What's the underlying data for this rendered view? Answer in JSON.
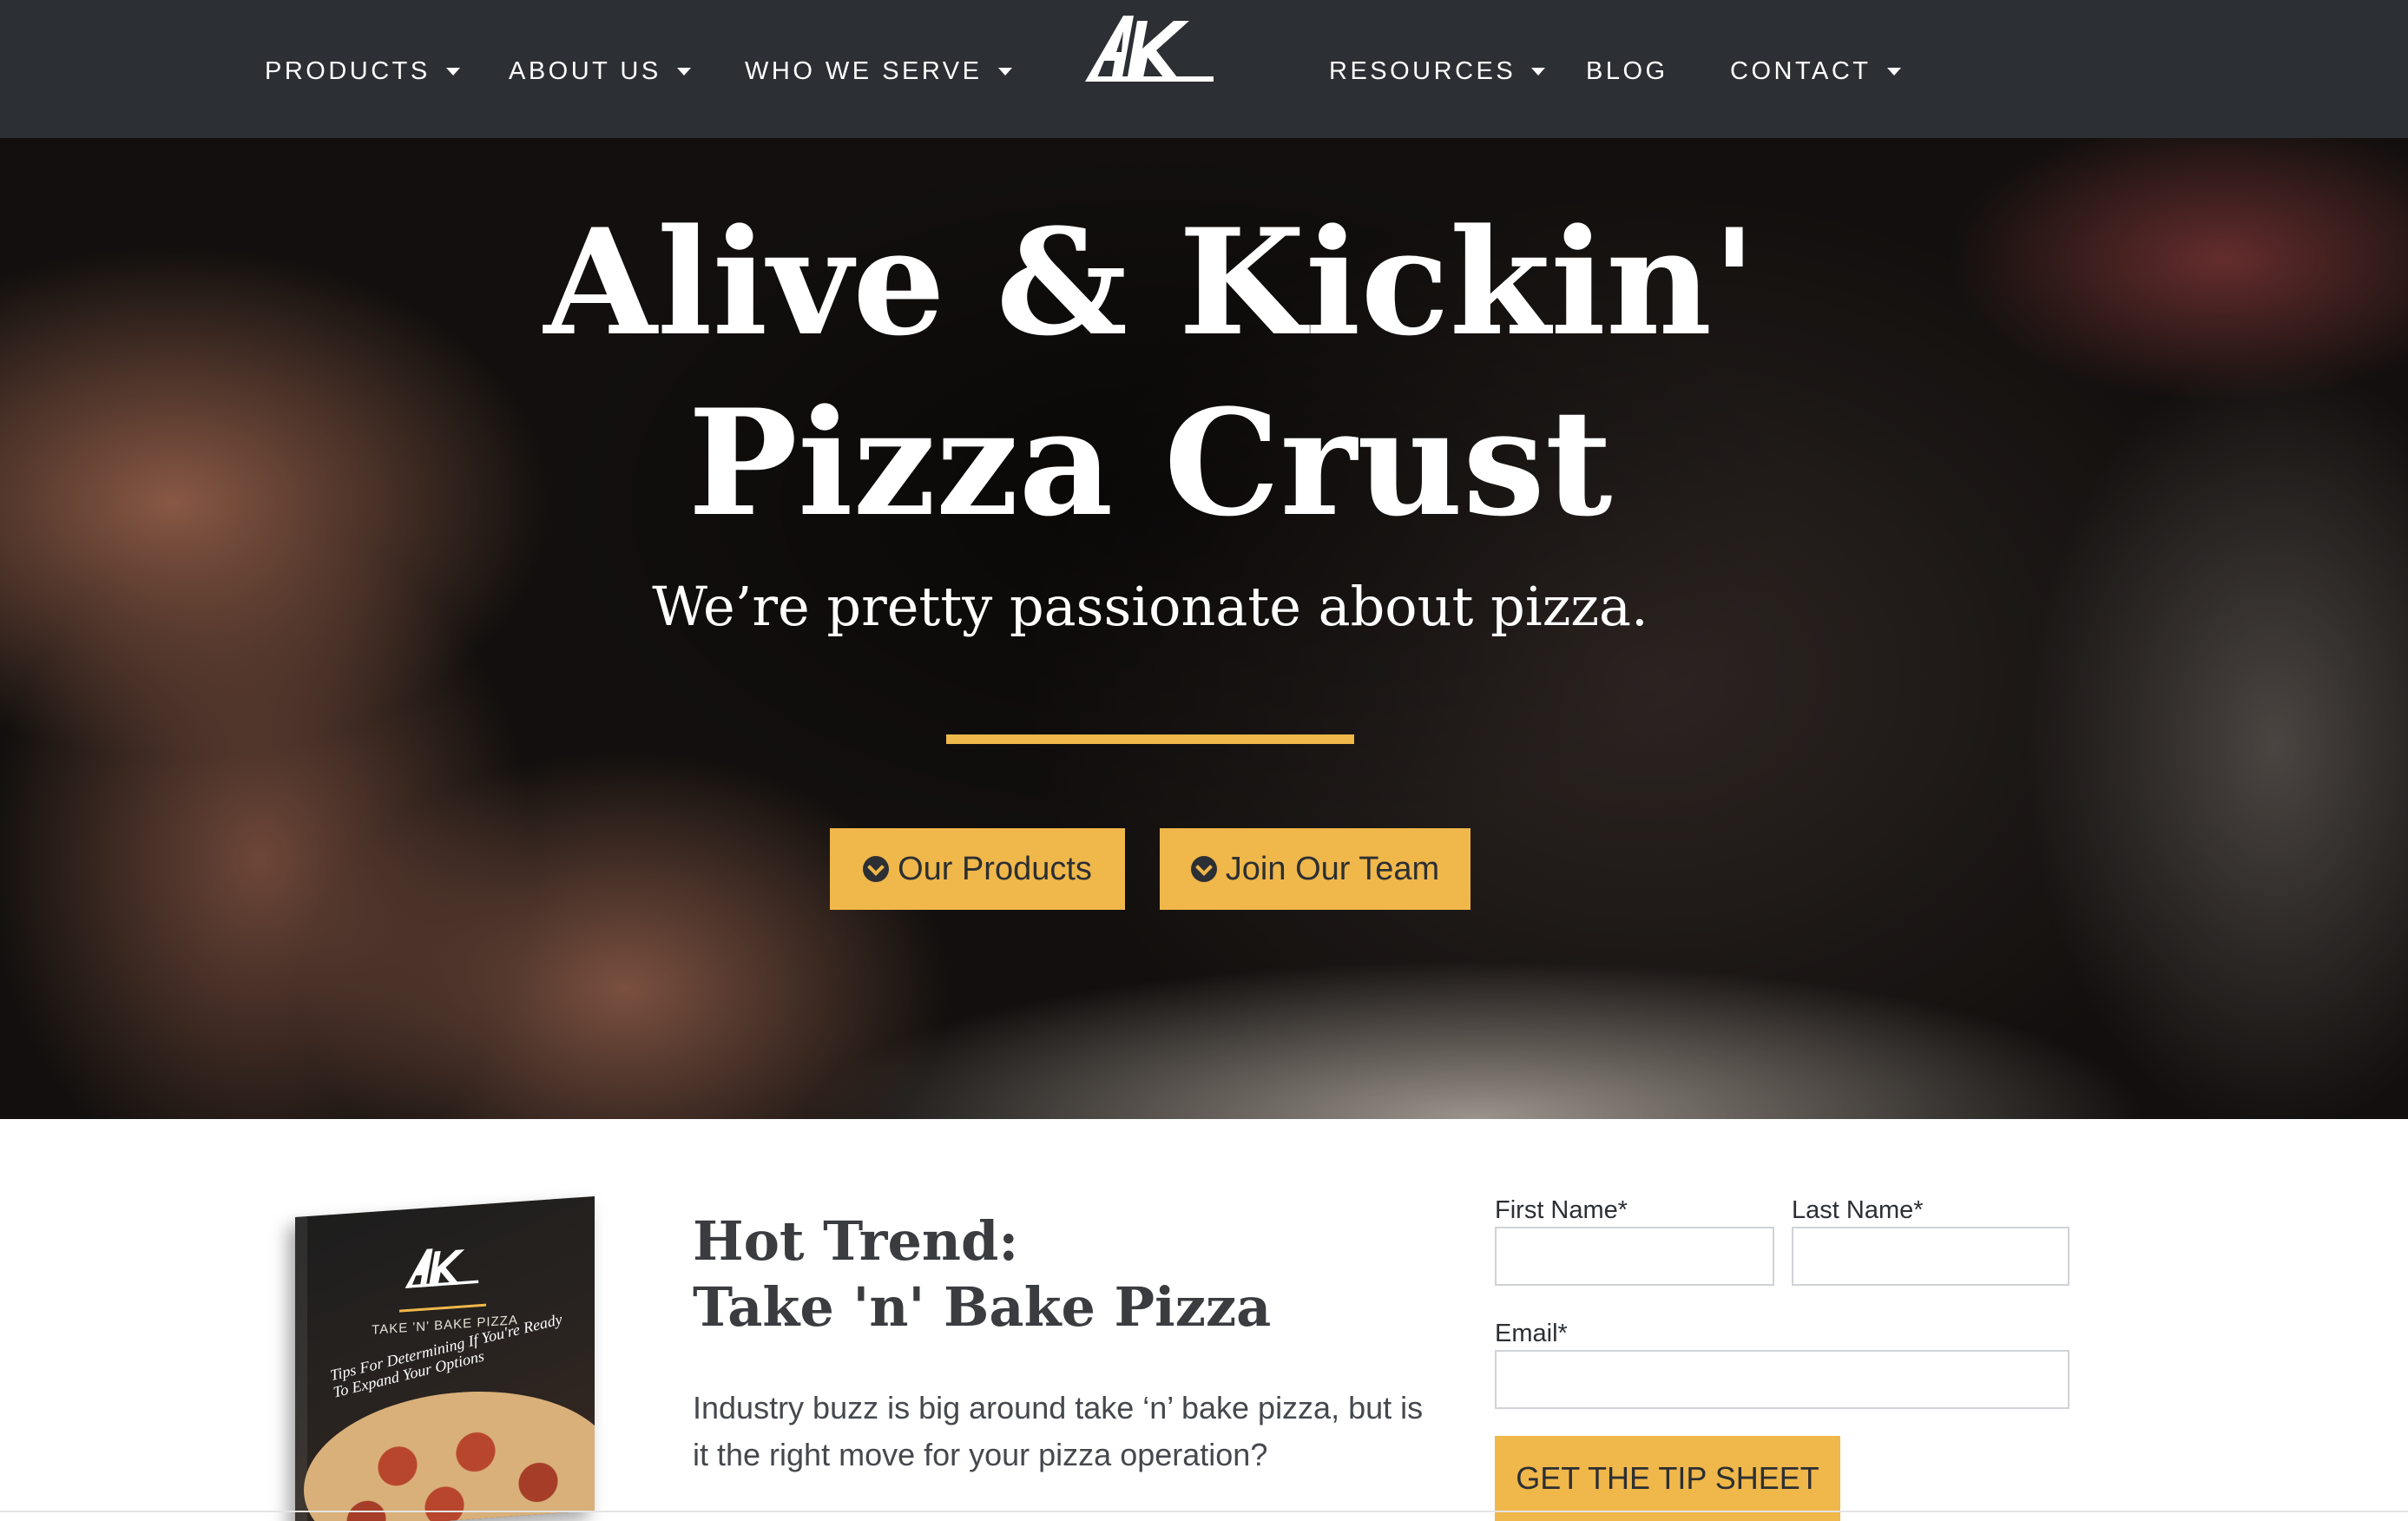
{
  "nav": {
    "items": [
      {
        "label": "PRODUCTS",
        "has_dropdown": true
      },
      {
        "label": "ABOUT US",
        "has_dropdown": true
      },
      {
        "label": "WHO WE SERVE",
        "has_dropdown": true
      },
      {
        "label": "RESOURCES",
        "has_dropdown": true
      },
      {
        "label": "BLOG",
        "has_dropdown": false
      },
      {
        "label": "CONTACT",
        "has_dropdown": true
      }
    ],
    "logo_text": "AK",
    "background": "#2c2f33"
  },
  "hero": {
    "title_line1": "Alive & Kickin'",
    "title_line2": "Pizza Crust",
    "subtitle": "We’re pretty passionate about pizza.",
    "buttons": [
      {
        "label": "Our Products",
        "icon": "chevron-circle-down-icon"
      },
      {
        "label": "Join Our Team",
        "icon": "chevron-circle-down-icon"
      }
    ],
    "accent": "#f0b74a"
  },
  "promo": {
    "book": {
      "logo_text": "AK",
      "kicker": "TAKE 'N' BAKE PIZZA",
      "title": "Tips For Determining If You're Ready To Expand Your Options"
    },
    "title_line1": "Hot Trend:",
    "title_line2": "Take 'n' Bake Pizza",
    "body": "Industry buzz is big around take ‘n’ bake pizza, but is it the right move for your pizza operation?"
  },
  "form": {
    "first_name_label": "First Name*",
    "last_name_label": "Last Name*",
    "email_label": "Email*",
    "first_name_value": "",
    "last_name_value": "",
    "email_value": "",
    "submit_label": "GET THE TIP SHEET"
  }
}
